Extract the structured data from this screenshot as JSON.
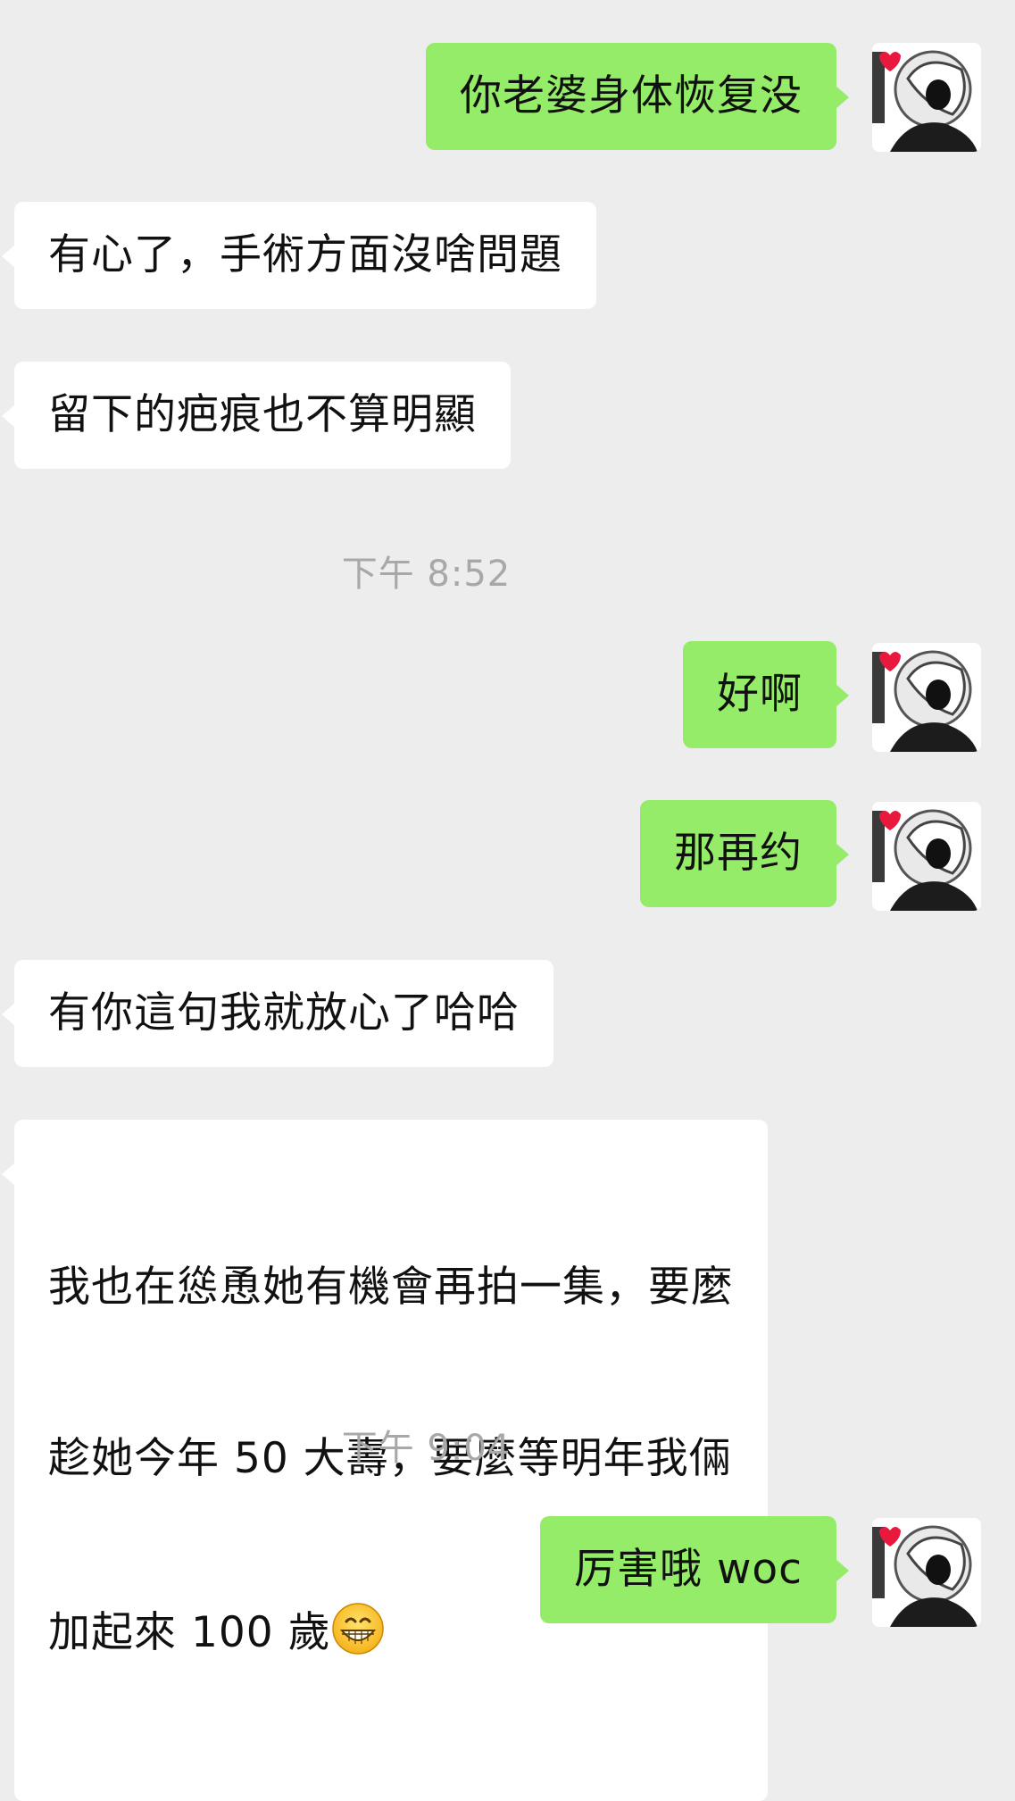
{
  "messages": {
    "m1": "你老婆身体恢复没",
    "m2": "有心了，手術方面沒啥問題",
    "m3": "留下的疤痕也不算明顯",
    "t1": "下午 8:52",
    "m4": "好啊",
    "m5": "那再约",
    "m6": "有你這句我就放心了哈哈",
    "m7_line1": "我也在慫恿她有機會再拍一集，要麼",
    "m7_line2": "趁她今年 50 大壽，要麼等明年我倆",
    "m7_line3": "加起來 100 歲",
    "t2": "下午 9:04",
    "m8": "厉害哦 woc"
  },
  "colors": {
    "background": "#ededed",
    "outgoing_bubble": "#95ec69",
    "incoming_bubble": "#ffffff",
    "timestamp": "#a8a8a8"
  },
  "icons": {
    "avatar": "cartoon-avatar",
    "emoji": "grinning-face-emoji"
  }
}
